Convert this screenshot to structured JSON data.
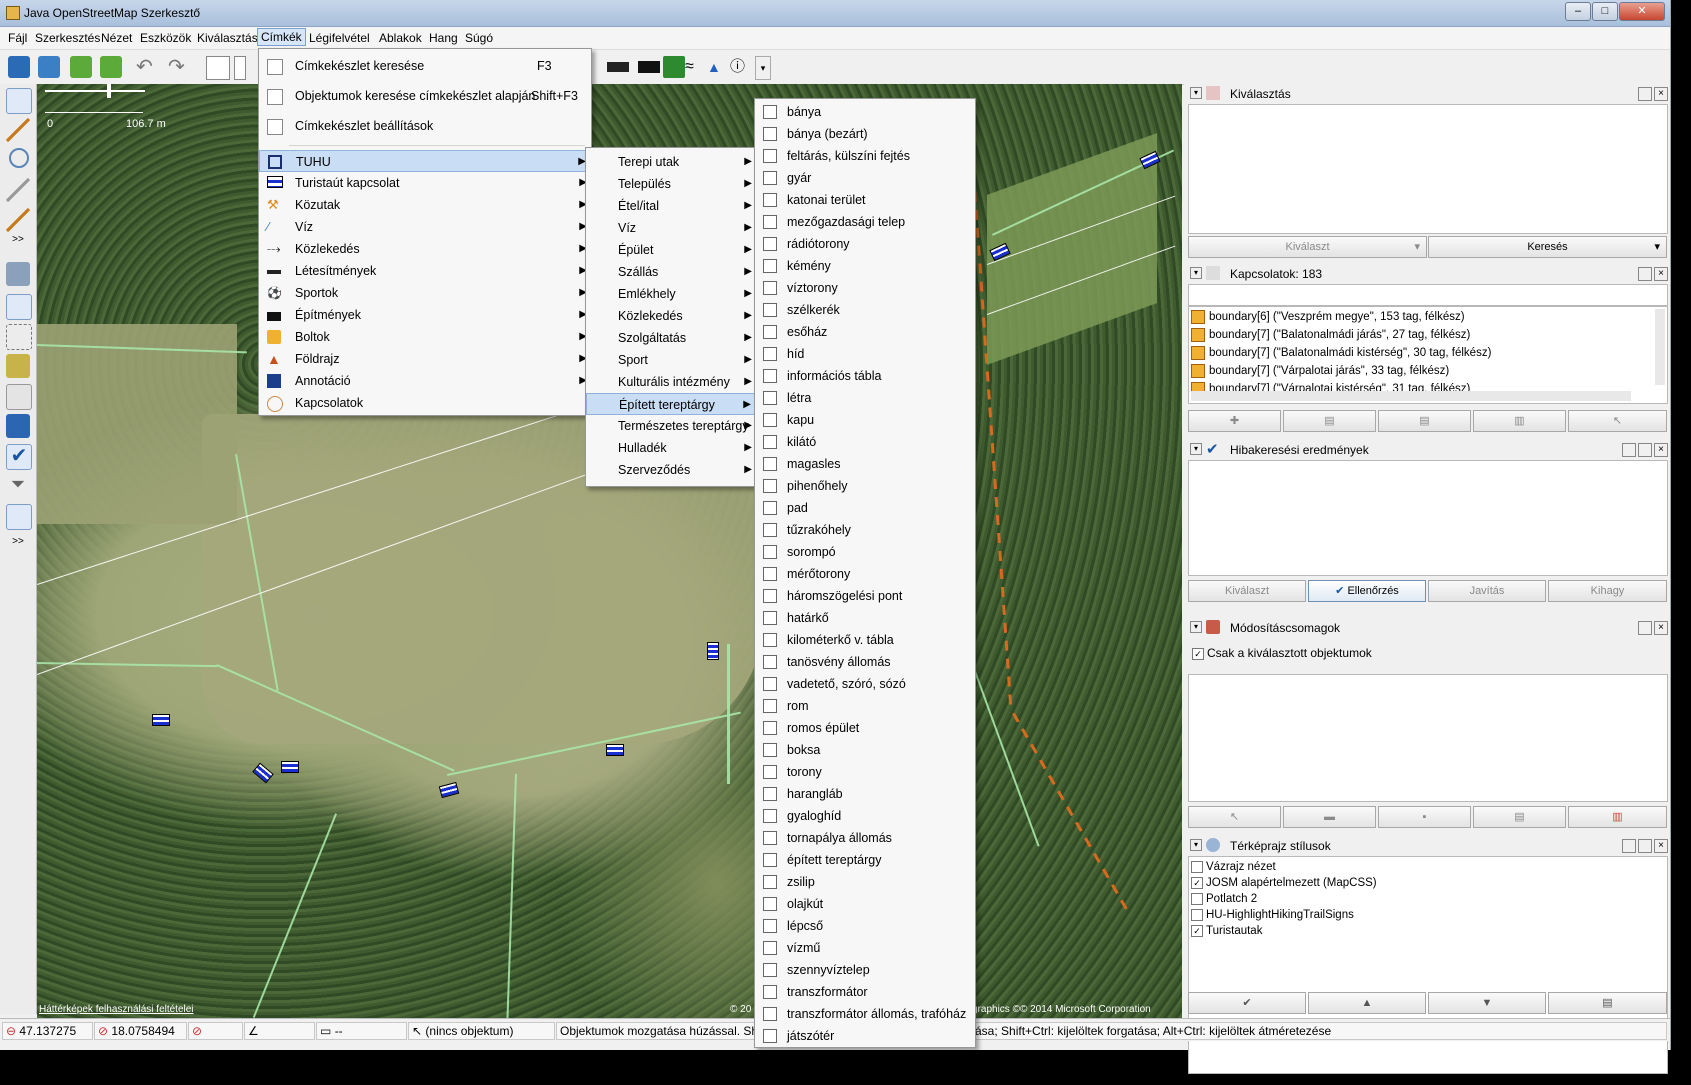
{
  "window": {
    "title": "Java OpenStreetMap Szerkesztő"
  },
  "menubar": [
    "Fájl",
    "Szerkesztés",
    "Nézet",
    "Eszközök",
    "Kiválasztás",
    "Címkék",
    "Légifelvétel",
    "Ablakok",
    "Hang",
    "Súgó"
  ],
  "tags_menu": {
    "top_items": [
      {
        "label": "Címkekészlet keresése",
        "shortcut": "F3"
      },
      {
        "label": "Objektumok keresése címkekészlet alapján",
        "shortcut": "Shift+F3"
      },
      {
        "label": "Címkekészlet beállítások",
        "shortcut": ""
      }
    ],
    "groups": [
      "TUHU",
      "Turistaút kapcsolat",
      "Közutak",
      "Víz",
      "Közlekedés",
      "Létesítmények",
      "Sportok",
      "Építmények",
      "Boltok",
      "Földrajz",
      "Annotáció",
      "Kapcsolatok"
    ],
    "highlighted_group": "TUHU"
  },
  "tuhu_menu": {
    "items": [
      "Terepi utak",
      "Település",
      "Étel/ital",
      "Víz",
      "Épület",
      "Szállás",
      "Emlékhely",
      "Közlekedés",
      "Szolgáltatás",
      "Sport",
      "Kulturális intézmény",
      "Épített tereptárgy",
      "Természetes tereptárgy",
      "Hulladék",
      "Szerveződés"
    ],
    "highlighted": "Épített tereptárgy"
  },
  "built_menu": {
    "items": [
      "bánya",
      "bánya (bezárt)",
      "feltárás, külszíni fejtés",
      "gyár",
      "katonai terület",
      "mezőgazdasági telep",
      "rádiótorony",
      "kémény",
      "víztorony",
      "szélkerék",
      "esőház",
      "híd",
      "információs tábla",
      "létra",
      "kapu",
      "kilátó",
      "magasles",
      "pihenőhely",
      "pad",
      "tűzrakóhely",
      "sorompó",
      "mérőtorony",
      "háromszögelési pont",
      "határkő",
      "kilométerkő v. tábla",
      "tanösvény állomás",
      "vadetető, szóró, sózó",
      "rom",
      "romos épület",
      "boksa",
      "torony",
      "harangláb",
      "gyaloghíd",
      "tornapálya állomás",
      "épített tereptárgy",
      "zsilip",
      "olajkút",
      "lépcső",
      "vízmű",
      "szennyvíztelep",
      "transzformátor",
      "transzformátor állomás, trafóház",
      "játszótér"
    ]
  },
  "map": {
    "scale_label_start": "0",
    "scale_label_end": "106.7 m",
    "attribution_left": "Háttérképek felhasználási feltételei",
    "attribution_right_a": "© 20",
    "attribution_right_b": "graphics  ©© 2014 Microsoft Corporation"
  },
  "panels": {
    "selection": {
      "title": "Kiválasztás",
      "btn_select": "Kiválaszt",
      "btn_search": "Keresés"
    },
    "relations": {
      "title": "Kapcsolatok: 183",
      "rows": [
        "boundary[6] (\"Veszprém megye\", 153 tag, félkész)",
        "boundary[7] (\"Balatonalmádi járás\", 27 tag, félkész)",
        "boundary[7] (\"Balatonalmádi kistérség\", 30 tag, félkész)",
        "boundary[7] (\"Várpalotai járás\", 33 tag, félkész)",
        "boundary[7] (\"Várpalotai kistérség\", 31 tag, félkész)"
      ]
    },
    "validation": {
      "title": "Hibakeresési eredmények",
      "buttons": [
        "Kiválaszt",
        "Ellenőrzés",
        "Javítás",
        "Kihagy"
      ]
    },
    "changesets": {
      "title": "Módosításcsomagok",
      "checkbox_label": "Csak a kiválasztott objektumok"
    },
    "styles": {
      "title": "Térképrajz stílusok",
      "rows": [
        {
          "label": "Vázrajz nézet",
          "checked": false
        },
        {
          "label": "JOSM alapértelmezett (MapCSS)",
          "checked": true
        },
        {
          "label": "Potlatch 2",
          "checked": false
        },
        {
          "label": "HU-HighlightHikingTrailSigns",
          "checked": false
        },
        {
          "label": "Turistautak",
          "checked": true
        }
      ]
    }
  },
  "status": {
    "lat": "47.137275",
    "lon": "18.0758494",
    "length": "--",
    "object": "(nincs objektum)",
    "help": "Objektumok mozgatása húzással. Shift: k",
    "help_right": "ása; Shift+Ctrl: kijelöltek forgatása; Alt+Ctrl: kijelöltek átméretezése"
  },
  "colors": {
    "menu_highlight": "#c9ddf5",
    "trail_green": "#a8e6a8",
    "boundary_orange": "#d66a1e"
  }
}
